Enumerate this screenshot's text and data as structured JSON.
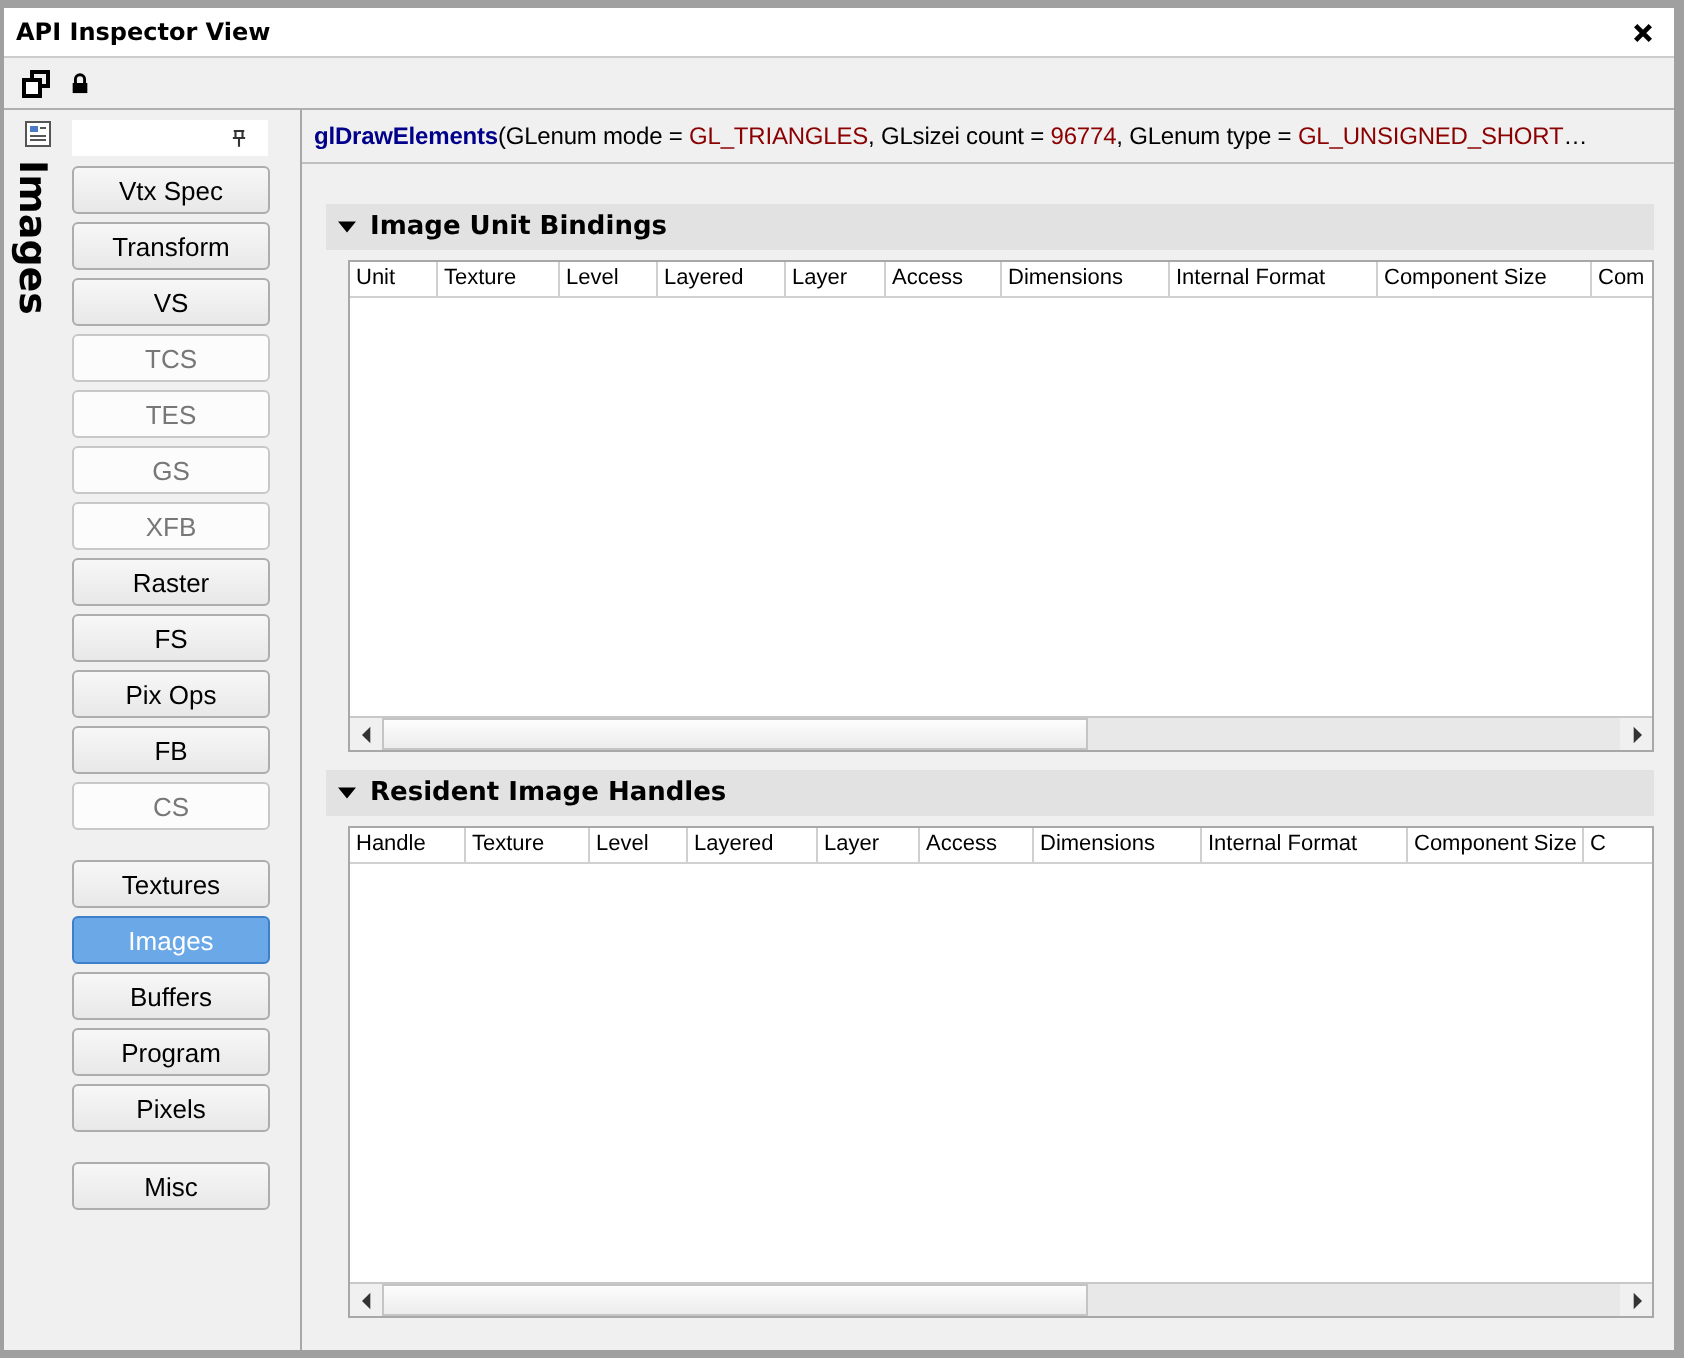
{
  "window": {
    "title": "API Inspector View"
  },
  "sidebar": {
    "vertical_label": "Images",
    "groups": [
      {
        "buttons": [
          {
            "label": "Vtx Spec",
            "disabled": false,
            "selected": false
          },
          {
            "label": "Transform",
            "disabled": false,
            "selected": false
          },
          {
            "label": "VS",
            "disabled": false,
            "selected": false
          },
          {
            "label": "TCS",
            "disabled": true,
            "selected": false
          },
          {
            "label": "TES",
            "disabled": true,
            "selected": false
          },
          {
            "label": "GS",
            "disabled": true,
            "selected": false
          },
          {
            "label": "XFB",
            "disabled": true,
            "selected": false
          },
          {
            "label": "Raster",
            "disabled": false,
            "selected": false
          },
          {
            "label": "FS",
            "disabled": false,
            "selected": false
          },
          {
            "label": "Pix Ops",
            "disabled": false,
            "selected": false
          },
          {
            "label": "FB",
            "disabled": false,
            "selected": false
          },
          {
            "label": "CS",
            "disabled": true,
            "selected": false
          }
        ]
      },
      {
        "buttons": [
          {
            "label": "Textures",
            "disabled": false,
            "selected": false
          },
          {
            "label": "Images",
            "disabled": false,
            "selected": true
          },
          {
            "label": "Buffers",
            "disabled": false,
            "selected": false
          },
          {
            "label": "Program",
            "disabled": false,
            "selected": false
          },
          {
            "label": "Pixels",
            "disabled": false,
            "selected": false
          }
        ]
      },
      {
        "buttons": [
          {
            "label": "Misc",
            "disabled": false,
            "selected": false
          }
        ]
      }
    ]
  },
  "call": [
    {
      "kind": "name",
      "text": "glDrawElements"
    },
    {
      "kind": "plain",
      "text": "(GLenum mode = "
    },
    {
      "kind": "value",
      "text": "GL_TRIANGLES"
    },
    {
      "kind": "plain",
      "text": ", GLsizei count = "
    },
    {
      "kind": "value",
      "text": "96774"
    },
    {
      "kind": "plain",
      "text": ", GLenum type = "
    },
    {
      "kind": "value",
      "text": "GL_UNSIGNED_SHORT"
    },
    {
      "kind": "plain",
      "text": "…"
    }
  ],
  "sections": [
    {
      "title": "Image Unit Bindings",
      "expanded": true,
      "columns": [
        "Unit",
        "Texture",
        "Level",
        "Layered",
        "Layer",
        "Access",
        "Dimensions",
        "Internal Format",
        "Component Size",
        "Com"
      ]
    },
    {
      "title": "Resident Image Handles",
      "expanded": true,
      "columns": [
        "Handle",
        "Texture",
        "Level",
        "Layered",
        "Layer",
        "Access",
        "Dimensions",
        "Internal Format",
        "Component Size",
        "C"
      ]
    }
  ]
}
